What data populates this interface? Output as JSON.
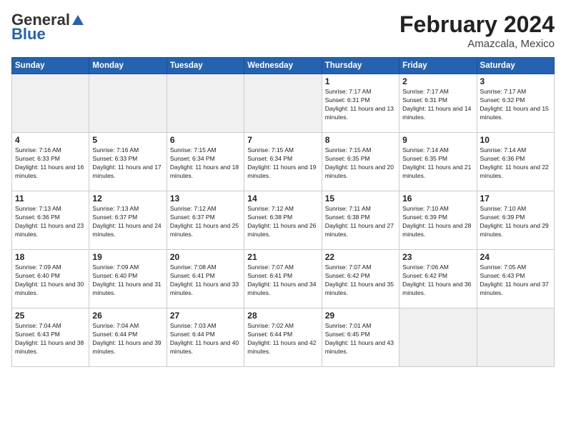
{
  "logo": {
    "general": "General",
    "blue": "Blue"
  },
  "title": "February 2024",
  "subtitle": "Amazcala, Mexico",
  "days_header": [
    "Sunday",
    "Monday",
    "Tuesday",
    "Wednesday",
    "Thursday",
    "Friday",
    "Saturday"
  ],
  "weeks": [
    [
      {
        "num": "",
        "info": ""
      },
      {
        "num": "",
        "info": ""
      },
      {
        "num": "",
        "info": ""
      },
      {
        "num": "",
        "info": ""
      },
      {
        "num": "1",
        "info": "Sunrise: 7:17 AM\nSunset: 6:31 PM\nDaylight: 11 hours and 13 minutes."
      },
      {
        "num": "2",
        "info": "Sunrise: 7:17 AM\nSunset: 6:31 PM\nDaylight: 11 hours and 14 minutes."
      },
      {
        "num": "3",
        "info": "Sunrise: 7:17 AM\nSunset: 6:32 PM\nDaylight: 11 hours and 15 minutes."
      }
    ],
    [
      {
        "num": "4",
        "info": "Sunrise: 7:16 AM\nSunset: 6:33 PM\nDaylight: 11 hours and 16 minutes."
      },
      {
        "num": "5",
        "info": "Sunrise: 7:16 AM\nSunset: 6:33 PM\nDaylight: 11 hours and 17 minutes."
      },
      {
        "num": "6",
        "info": "Sunrise: 7:15 AM\nSunset: 6:34 PM\nDaylight: 11 hours and 18 minutes."
      },
      {
        "num": "7",
        "info": "Sunrise: 7:15 AM\nSunset: 6:34 PM\nDaylight: 11 hours and 19 minutes."
      },
      {
        "num": "8",
        "info": "Sunrise: 7:15 AM\nSunset: 6:35 PM\nDaylight: 11 hours and 20 minutes."
      },
      {
        "num": "9",
        "info": "Sunrise: 7:14 AM\nSunset: 6:35 PM\nDaylight: 11 hours and 21 minutes."
      },
      {
        "num": "10",
        "info": "Sunrise: 7:14 AM\nSunset: 6:36 PM\nDaylight: 11 hours and 22 minutes."
      }
    ],
    [
      {
        "num": "11",
        "info": "Sunrise: 7:13 AM\nSunset: 6:36 PM\nDaylight: 11 hours and 23 minutes."
      },
      {
        "num": "12",
        "info": "Sunrise: 7:13 AM\nSunset: 6:37 PM\nDaylight: 11 hours and 24 minutes."
      },
      {
        "num": "13",
        "info": "Sunrise: 7:12 AM\nSunset: 6:37 PM\nDaylight: 11 hours and 25 minutes."
      },
      {
        "num": "14",
        "info": "Sunrise: 7:12 AM\nSunset: 6:38 PM\nDaylight: 11 hours and 26 minutes."
      },
      {
        "num": "15",
        "info": "Sunrise: 7:11 AM\nSunset: 6:38 PM\nDaylight: 11 hours and 27 minutes."
      },
      {
        "num": "16",
        "info": "Sunrise: 7:10 AM\nSunset: 6:39 PM\nDaylight: 11 hours and 28 minutes."
      },
      {
        "num": "17",
        "info": "Sunrise: 7:10 AM\nSunset: 6:39 PM\nDaylight: 11 hours and 29 minutes."
      }
    ],
    [
      {
        "num": "18",
        "info": "Sunrise: 7:09 AM\nSunset: 6:40 PM\nDaylight: 11 hours and 30 minutes."
      },
      {
        "num": "19",
        "info": "Sunrise: 7:09 AM\nSunset: 6:40 PM\nDaylight: 11 hours and 31 minutes."
      },
      {
        "num": "20",
        "info": "Sunrise: 7:08 AM\nSunset: 6:41 PM\nDaylight: 11 hours and 33 minutes."
      },
      {
        "num": "21",
        "info": "Sunrise: 7:07 AM\nSunset: 6:41 PM\nDaylight: 11 hours and 34 minutes."
      },
      {
        "num": "22",
        "info": "Sunrise: 7:07 AM\nSunset: 6:42 PM\nDaylight: 11 hours and 35 minutes."
      },
      {
        "num": "23",
        "info": "Sunrise: 7:06 AM\nSunset: 6:42 PM\nDaylight: 11 hours and 36 minutes."
      },
      {
        "num": "24",
        "info": "Sunrise: 7:05 AM\nSunset: 6:43 PM\nDaylight: 11 hours and 37 minutes."
      }
    ],
    [
      {
        "num": "25",
        "info": "Sunrise: 7:04 AM\nSunset: 6:43 PM\nDaylight: 11 hours and 38 minutes."
      },
      {
        "num": "26",
        "info": "Sunrise: 7:04 AM\nSunset: 6:44 PM\nDaylight: 11 hours and 39 minutes."
      },
      {
        "num": "27",
        "info": "Sunrise: 7:03 AM\nSunset: 6:44 PM\nDaylight: 11 hours and 40 minutes."
      },
      {
        "num": "28",
        "info": "Sunrise: 7:02 AM\nSunset: 6:44 PM\nDaylight: 11 hours and 42 minutes."
      },
      {
        "num": "29",
        "info": "Sunrise: 7:01 AM\nSunset: 6:45 PM\nDaylight: 11 hours and 43 minutes."
      },
      {
        "num": "",
        "info": ""
      },
      {
        "num": "",
        "info": ""
      }
    ]
  ]
}
